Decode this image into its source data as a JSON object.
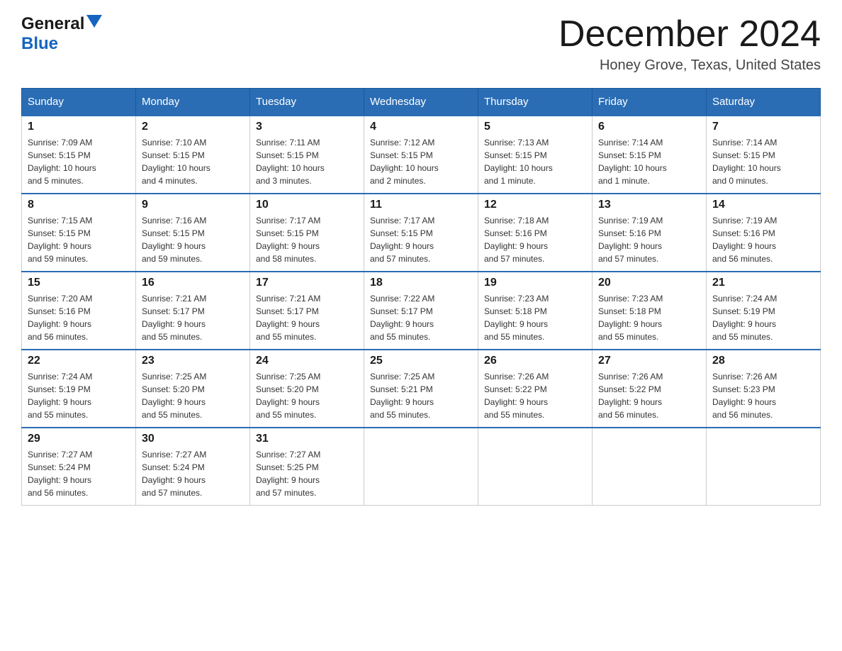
{
  "header": {
    "logo_general": "General",
    "logo_blue": "Blue",
    "month_title": "December 2024",
    "location": "Honey Grove, Texas, United States"
  },
  "days_of_week": [
    "Sunday",
    "Monday",
    "Tuesday",
    "Wednesday",
    "Thursday",
    "Friday",
    "Saturday"
  ],
  "weeks": [
    [
      {
        "num": "1",
        "sunrise": "7:09 AM",
        "sunset": "5:15 PM",
        "daylight": "10 hours and 5 minutes."
      },
      {
        "num": "2",
        "sunrise": "7:10 AM",
        "sunset": "5:15 PM",
        "daylight": "10 hours and 4 minutes."
      },
      {
        "num": "3",
        "sunrise": "7:11 AM",
        "sunset": "5:15 PM",
        "daylight": "10 hours and 3 minutes."
      },
      {
        "num": "4",
        "sunrise": "7:12 AM",
        "sunset": "5:15 PM",
        "daylight": "10 hours and 2 minutes."
      },
      {
        "num": "5",
        "sunrise": "7:13 AM",
        "sunset": "5:15 PM",
        "daylight": "10 hours and 1 minute."
      },
      {
        "num": "6",
        "sunrise": "7:14 AM",
        "sunset": "5:15 PM",
        "daylight": "10 hours and 1 minute."
      },
      {
        "num": "7",
        "sunrise": "7:14 AM",
        "sunset": "5:15 PM",
        "daylight": "10 hours and 0 minutes."
      }
    ],
    [
      {
        "num": "8",
        "sunrise": "7:15 AM",
        "sunset": "5:15 PM",
        "daylight": "9 hours and 59 minutes."
      },
      {
        "num": "9",
        "sunrise": "7:16 AM",
        "sunset": "5:15 PM",
        "daylight": "9 hours and 59 minutes."
      },
      {
        "num": "10",
        "sunrise": "7:17 AM",
        "sunset": "5:15 PM",
        "daylight": "9 hours and 58 minutes."
      },
      {
        "num": "11",
        "sunrise": "7:17 AM",
        "sunset": "5:15 PM",
        "daylight": "9 hours and 57 minutes."
      },
      {
        "num": "12",
        "sunrise": "7:18 AM",
        "sunset": "5:16 PM",
        "daylight": "9 hours and 57 minutes."
      },
      {
        "num": "13",
        "sunrise": "7:19 AM",
        "sunset": "5:16 PM",
        "daylight": "9 hours and 57 minutes."
      },
      {
        "num": "14",
        "sunrise": "7:19 AM",
        "sunset": "5:16 PM",
        "daylight": "9 hours and 56 minutes."
      }
    ],
    [
      {
        "num": "15",
        "sunrise": "7:20 AM",
        "sunset": "5:16 PM",
        "daylight": "9 hours and 56 minutes."
      },
      {
        "num": "16",
        "sunrise": "7:21 AM",
        "sunset": "5:17 PM",
        "daylight": "9 hours and 55 minutes."
      },
      {
        "num": "17",
        "sunrise": "7:21 AM",
        "sunset": "5:17 PM",
        "daylight": "9 hours and 55 minutes."
      },
      {
        "num": "18",
        "sunrise": "7:22 AM",
        "sunset": "5:17 PM",
        "daylight": "9 hours and 55 minutes."
      },
      {
        "num": "19",
        "sunrise": "7:23 AM",
        "sunset": "5:18 PM",
        "daylight": "9 hours and 55 minutes."
      },
      {
        "num": "20",
        "sunrise": "7:23 AM",
        "sunset": "5:18 PM",
        "daylight": "9 hours and 55 minutes."
      },
      {
        "num": "21",
        "sunrise": "7:24 AM",
        "sunset": "5:19 PM",
        "daylight": "9 hours and 55 minutes."
      }
    ],
    [
      {
        "num": "22",
        "sunrise": "7:24 AM",
        "sunset": "5:19 PM",
        "daylight": "9 hours and 55 minutes."
      },
      {
        "num": "23",
        "sunrise": "7:25 AM",
        "sunset": "5:20 PM",
        "daylight": "9 hours and 55 minutes."
      },
      {
        "num": "24",
        "sunrise": "7:25 AM",
        "sunset": "5:20 PM",
        "daylight": "9 hours and 55 minutes."
      },
      {
        "num": "25",
        "sunrise": "7:25 AM",
        "sunset": "5:21 PM",
        "daylight": "9 hours and 55 minutes."
      },
      {
        "num": "26",
        "sunrise": "7:26 AM",
        "sunset": "5:22 PM",
        "daylight": "9 hours and 55 minutes."
      },
      {
        "num": "27",
        "sunrise": "7:26 AM",
        "sunset": "5:22 PM",
        "daylight": "9 hours and 56 minutes."
      },
      {
        "num": "28",
        "sunrise": "7:26 AM",
        "sunset": "5:23 PM",
        "daylight": "9 hours and 56 minutes."
      }
    ],
    [
      {
        "num": "29",
        "sunrise": "7:27 AM",
        "sunset": "5:24 PM",
        "daylight": "9 hours and 56 minutes."
      },
      {
        "num": "30",
        "sunrise": "7:27 AM",
        "sunset": "5:24 PM",
        "daylight": "9 hours and 57 minutes."
      },
      {
        "num": "31",
        "sunrise": "7:27 AM",
        "sunset": "5:25 PM",
        "daylight": "9 hours and 57 minutes."
      },
      null,
      null,
      null,
      null
    ]
  ],
  "labels": {
    "sunrise": "Sunrise:",
    "sunset": "Sunset:",
    "daylight": "Daylight:"
  }
}
